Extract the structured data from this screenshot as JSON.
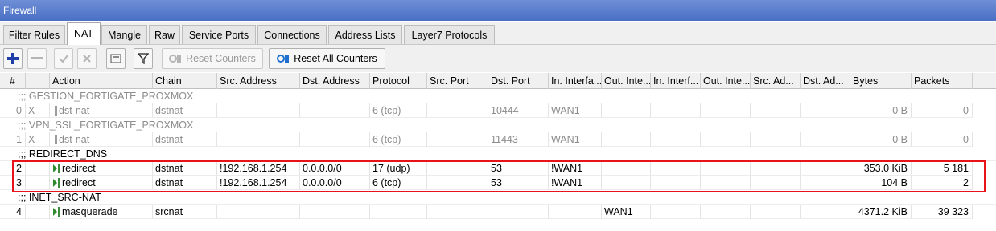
{
  "window": {
    "title": "Firewall"
  },
  "tabs": [
    {
      "label": "Filter Rules",
      "active": false
    },
    {
      "label": "NAT",
      "active": true
    },
    {
      "label": "Mangle",
      "active": false
    },
    {
      "label": "Raw",
      "active": false
    },
    {
      "label": "Service Ports",
      "active": false
    },
    {
      "label": "Connections",
      "active": false
    },
    {
      "label": "Address Lists",
      "active": false
    },
    {
      "label": "Layer7 Protocols",
      "active": false
    }
  ],
  "toolbar": {
    "add_icon": "plus-icon",
    "remove_icon": "minus-icon",
    "enable_icon": "check-icon",
    "disable_icon": "cross-icon",
    "comment_icon": "comment-icon",
    "filter_icon": "filter-icon",
    "reset_counters": "Reset Counters",
    "reset_all_counters": "Reset All Counters"
  },
  "columns": [
    "#",
    "",
    "Action",
    "Chain",
    "Src. Address",
    "Dst. Address",
    "Protocol",
    "Src. Port",
    "Dst. Port",
    "In. Interfa...",
    "Out. Inte...",
    "In. Interf...",
    "Out. Inte...",
    "Src. Ad...",
    "Dst. Ad...",
    "Bytes",
    "Packets"
  ],
  "groups": [
    {
      "comment": ";;; GESTION_FORTIGATE_PROXMOX",
      "dim": true,
      "rule": {
        "num": "0",
        "flag": "X",
        "action": "dst-nat",
        "chain": "dstnat",
        "src": "",
        "dst": "",
        "protocol": "6 (tcp)",
        "src_port": "",
        "dst_port": "10444",
        "in_iface": "WAN1",
        "out_iface": "",
        "bytes": "0 B",
        "packets": "0",
        "disabled": true
      }
    },
    {
      "comment": ";;; VPN_SSL_FORTIGATE_PROXMOX",
      "dim": true,
      "rule": {
        "num": "1",
        "flag": "X",
        "action": "dst-nat",
        "chain": "dstnat",
        "src": "",
        "dst": "",
        "protocol": "6 (tcp)",
        "src_port": "",
        "dst_port": "11443",
        "in_iface": "WAN1",
        "out_iface": "",
        "bytes": "0 B",
        "packets": "0",
        "disabled": true
      }
    }
  ],
  "redirect_group": {
    "comment": ";;; REDIRECT_DNS"
  },
  "redirect_rules": [
    {
      "num": "2",
      "flag": "",
      "action": "redirect",
      "chain": "dstnat",
      "src": "!192.168.1.254",
      "dst": "0.0.0.0/0",
      "protocol": "17 (udp)",
      "src_port": "",
      "dst_port": "53",
      "in_iface": "!WAN1",
      "out_iface": "",
      "bytes": "353.0 KiB",
      "packets": "5 181"
    },
    {
      "num": "3",
      "flag": "",
      "action": "redirect",
      "chain": "dstnat",
      "src": "!192.168.1.254",
      "dst": "0.0.0.0/0",
      "protocol": "6 (tcp)",
      "src_port": "",
      "dst_port": "53",
      "in_iface": "!WAN1",
      "out_iface": "",
      "bytes": "104 B",
      "packets": "2"
    }
  ],
  "masq_group": {
    "comment": ";;; INET_SRC-NAT"
  },
  "masq_rule": {
    "num": "4",
    "flag": "",
    "action": "masquerade",
    "chain": "srcnat",
    "src": "",
    "dst": "",
    "protocol": "",
    "src_port": "",
    "dst_port": "",
    "in_iface": "",
    "out_iface": "WAN1",
    "bytes": "4371.2 KiB",
    "packets": "39 323"
  },
  "highlight_color": "#e8121b"
}
